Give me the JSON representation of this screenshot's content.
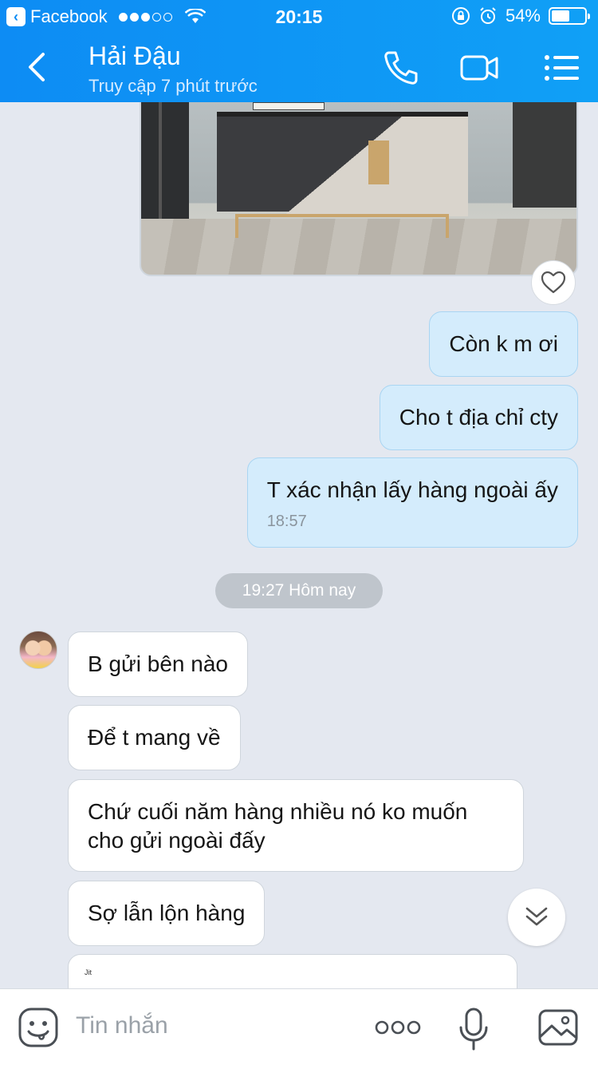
{
  "status_bar": {
    "back_app_label": "Facebook",
    "time": "20:15",
    "battery_percent": "54%",
    "battery_level": 0.54
  },
  "header": {
    "contact_name": "Hải Đậu",
    "contact_status": "Truy cập 7 phút trước"
  },
  "messages_out": [
    {
      "text": "Còn k m ơi"
    },
    {
      "text": "Cho t địa chỉ cty"
    },
    {
      "text": "T xác nhận lấy hàng ngoài ấy",
      "time": "18:57"
    }
  ],
  "date_separator": "19:27 Hôm nay",
  "messages_in": [
    {
      "text": "B gửi bên nào"
    },
    {
      "text": "Để t mang về"
    },
    {
      "text": "Chứ cuối năm hàng nhiều nó ko muốn cho gửi ngoài đấy"
    },
    {
      "text": "Sợ lẫn lộn hàng"
    },
    {
      "text": "",
      "tiny": "Jit"
    }
  ],
  "composer": {
    "placeholder": "Tin nhắn"
  },
  "colors": {
    "header_blue": "#0d8cf4",
    "outgoing_bubble": "#d4ecfc",
    "incoming_bubble": "#ffffff",
    "chat_background": "#e4e8f0"
  },
  "icons": [
    "back-arrow-icon",
    "phone-icon",
    "video-call-icon",
    "menu-list-icon",
    "heart-icon",
    "double-chevron-down-icon",
    "emoji-icon",
    "more-dots-icon",
    "microphone-icon",
    "gallery-icon"
  ]
}
